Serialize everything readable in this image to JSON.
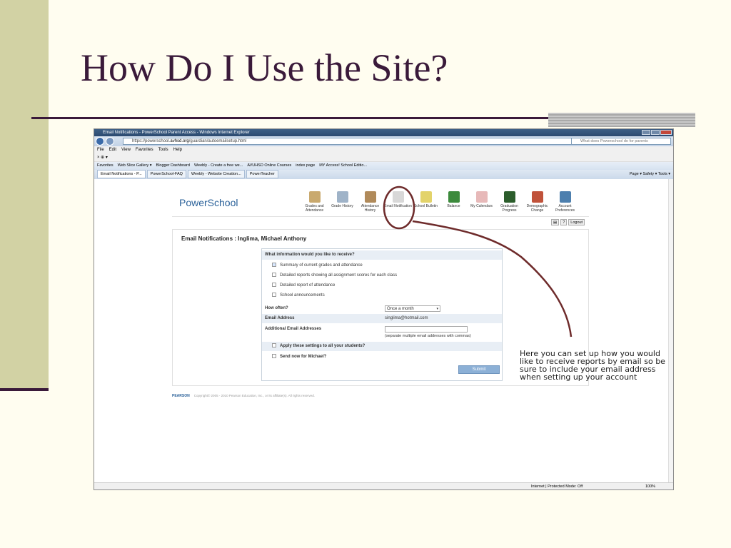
{
  "slide": {
    "title": "How Do I Use the Site?"
  },
  "browser": {
    "window_title": "Email Notifications - PowerSchool Parent Access - Windows Internet Explorer",
    "url_prefix": "https://powerschool.",
    "url_domain": "avhsd.org",
    "url_path": "/guardian/autoemailsetup.html",
    "search_placeholder": "What does Powerschool do for parents",
    "menu": [
      "File",
      "Edit",
      "View",
      "Favorites",
      "Tools",
      "Help"
    ],
    "toolrow_text": "×  ⊕ ▾",
    "favorites": [
      "Favorites",
      "Web Slice Gallery ▾",
      "Blogger Dashboard",
      "Weebly - Create a free we...",
      "AVUHSD Online Courses",
      "index page",
      "MY Access! School Editio..."
    ],
    "tabs": [
      "Email Notifications - P...",
      "PowerSchool-FAQ",
      "Weebly - Website Creation...",
      "PowerTeacher"
    ],
    "command_bar": "Page ▾  Safety ▾  Tools ▾",
    "status_zone": "Internet | Protected Mode: Off",
    "zoom": "100%"
  },
  "powerschool": {
    "logo": "PowerSchool",
    "nav": [
      {
        "label": "Grades and Attendance",
        "color": "#c9a96e"
      },
      {
        "label": "Grade History",
        "color": "#9fb3c8"
      },
      {
        "label": "Attendance History",
        "color": "#b08a5a"
      },
      {
        "label": "Email Notification",
        "color": "#d8d8d8"
      },
      {
        "label": "School Bulletin",
        "color": "#e3d36a"
      },
      {
        "label": "Balance",
        "color": "#3c8a3c"
      },
      {
        "label": "My Calendars",
        "color": "#e7b9b9"
      },
      {
        "label": "Graduation Progress",
        "color": "#2c5d2c"
      },
      {
        "label": "Demographic Change",
        "color": "#c0523a"
      },
      {
        "label": "Account Preferences",
        "color": "#4d7fae"
      }
    ],
    "logout": "Logout",
    "heading": "Email Notifications : Inglima, Michael Anthony",
    "form": {
      "question": "What information would you like to receive?",
      "options": [
        "Summary of current grades and attendance",
        "Detailed reports showing all assignment scores for each class",
        "Detailed report of attendance",
        "School announcements"
      ],
      "how_often_label": "How often?",
      "how_often_value": "Once a month",
      "email_label": "Email Address",
      "email_value": "singlima@hotmail.com",
      "additional_label": "Additional Email Addresses",
      "additional_hint": "(separate multiple email addresses with commas)",
      "apply_all": "Apply these settings to all your students?",
      "send_now": "Send now for Michael?",
      "submit": "Submit"
    },
    "footer_brand": "PEARSON",
    "footer_text": "Copyright© 2005 - 2010 Pearson Education, Inc., or its affiliate(s). All rights reserved."
  },
  "annotation": "Here you can set up how you would like to receive reports by email so be sure to include your email address when setting up your account"
}
